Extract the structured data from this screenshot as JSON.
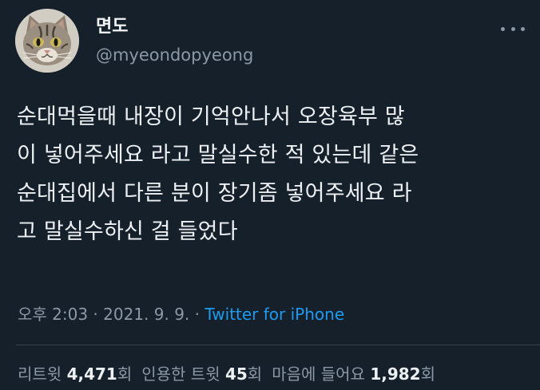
{
  "user": {
    "display_name": "면도",
    "handle": "@myeondopyeong"
  },
  "tweet": {
    "lines": [
      "순대먹을때 내장이 기억안나서 오장육부 많",
      "이 넣어주세요 라고 말실수한 적 있는데 같은",
      "순대집에서 다른 분이 장기좀 넣어주세요 라",
      "고 말실수하신 걸 들었다"
    ]
  },
  "meta": {
    "time": "오후 2:03",
    "separator": " · ",
    "date": "2021. 9. 9.",
    "separator2": " · ",
    "source": "Twitter for iPhone"
  },
  "stats": {
    "retweets_label": "리트윗",
    "retweets_count": "4,471",
    "retweets_unit": "회",
    "quotes_label": "인용한 트윗",
    "quotes_count": "45",
    "quotes_unit": "회",
    "likes_label": "마음에 들어요",
    "likes_count": "1,982",
    "likes_unit": "회"
  },
  "icons": {
    "avatar": "cat-photo-avatar",
    "more": "more-options-icon"
  },
  "colors": {
    "background": "#15202b",
    "link": "#1d9bf0",
    "secondary_text": "#8b98a5"
  }
}
